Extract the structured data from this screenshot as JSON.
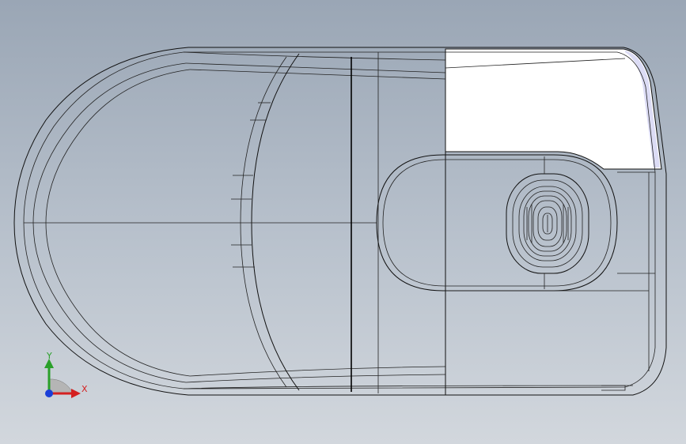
{
  "triad": {
    "x_label": "X",
    "y_label": "Y",
    "colors": {
      "x": "#d42020",
      "y": "#2aa02a",
      "z": "#1a3fd8"
    }
  },
  "colors": {
    "background_top": "#9aa6b5",
    "background_bottom": "#d2d7dd",
    "edges": "#111111",
    "highlight_face": "#ffffff"
  }
}
